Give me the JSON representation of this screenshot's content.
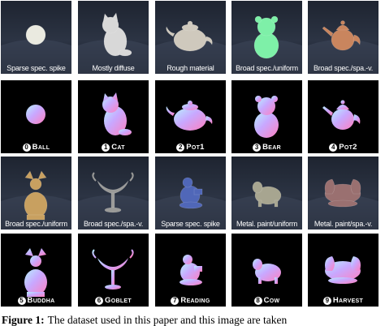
{
  "figure": {
    "photo_rows": [
      [
        "Sparse spec. spike",
        "Mostly diffuse",
        "Rough material",
        "Broad spec./uniform",
        "Broad spec./spa.-v."
      ],
      [
        "Broad spec./uniform",
        "Broad spec./spa.-v.",
        "Sparse spec. spike",
        "Metal. paint/uniform",
        "Metal. paint/spa.-v."
      ]
    ],
    "objects": [
      {
        "num": "0",
        "name": "Ball"
      },
      {
        "num": "1",
        "name": "Cat"
      },
      {
        "num": "2",
        "name": "Pot1"
      },
      {
        "num": "3",
        "name": "Bear"
      },
      {
        "num": "4",
        "name": "Pot2"
      },
      {
        "num": "5",
        "name": "Buddha"
      },
      {
        "num": "6",
        "name": "Goblet"
      },
      {
        "num": "7",
        "name": "Reading"
      },
      {
        "num": "8",
        "name": "Cow"
      },
      {
        "num": "9",
        "name": "Harvest"
      }
    ],
    "caption_label": "Figure 1:",
    "caption_text": "The dataset used in this paper and this image are taken"
  }
}
